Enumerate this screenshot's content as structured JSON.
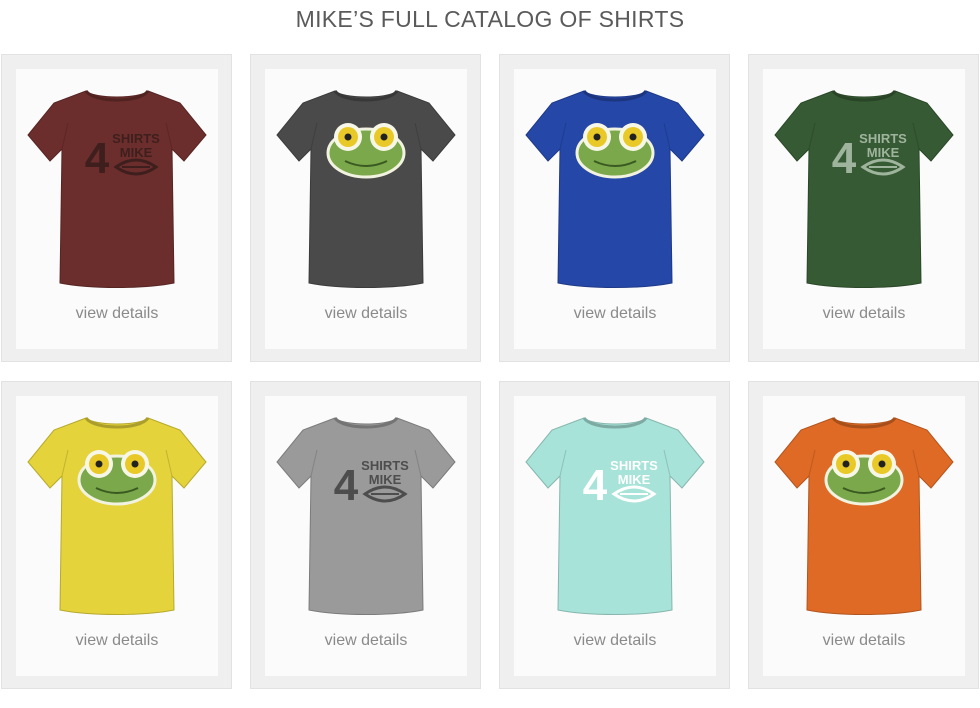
{
  "page": {
    "title": "MIKE’S FULL CATALOG OF SHIRTS"
  },
  "shirts": [
    {
      "color": "#6b2e2c",
      "design": "shirts4mike-logo",
      "logo_color": "#3e1f1e",
      "link_label": "view details"
    },
    {
      "color": "#4a4a4a",
      "design": "frog-face",
      "logo_color": "",
      "link_label": "view details"
    },
    {
      "color": "#2547a8",
      "design": "frog-face",
      "logo_color": "",
      "link_label": "view details"
    },
    {
      "color": "#365a33",
      "design": "shirts4mike-logo",
      "logo_color": "#9fb49c",
      "link_label": "view details"
    },
    {
      "color": "#e4d33a",
      "design": "frog-face",
      "logo_color": "",
      "link_label": "view details"
    },
    {
      "color": "#9a9a9a",
      "design": "shirts4mike-logo",
      "logo_color": "#4d4d4d",
      "link_label": "view details"
    },
    {
      "color": "#a7e3d8",
      "design": "shirts4mike-logo",
      "logo_color": "#ffffff",
      "link_label": "view details"
    },
    {
      "color": "#df6a25",
      "design": "frog-face",
      "logo_color": "",
      "link_label": "view details"
    }
  ],
  "logo_text": {
    "line1": "SHIRTS",
    "line2": "MIKE",
    "numeral": "4"
  }
}
